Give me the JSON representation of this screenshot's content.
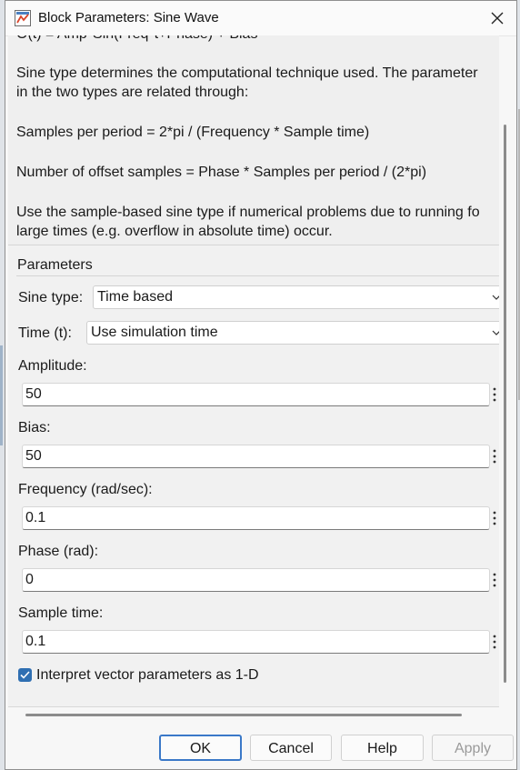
{
  "window": {
    "title": "Block Parameters: Sine Wave"
  },
  "description": {
    "formula_partial": "O(t) = Amp*Sin(Freq*t+Phase) + Bias",
    "line1": "Sine type determines the computational technique used. The parameter",
    "line2": "in the two types are related through:",
    "line3": "Samples per period = 2*pi / (Frequency * Sample time)",
    "line4": "Number of offset samples = Phase * Samples per period / (2*pi)",
    "line5": "Use the sample-based sine type if numerical problems due to running fo",
    "line6": "large times (e.g. overflow in absolute time) occur."
  },
  "parameters": {
    "group_label": "Parameters",
    "sine_type": {
      "label": "Sine type:",
      "value": "Time based"
    },
    "time": {
      "label": "Time (t):",
      "value": "Use simulation time"
    },
    "amplitude": {
      "label": "Amplitude:",
      "value": "50"
    },
    "bias": {
      "label": "Bias:",
      "value": "50"
    },
    "frequency": {
      "label": "Frequency (rad/sec):",
      "value": "0.1"
    },
    "phase": {
      "label": "Phase (rad):",
      "value": "0"
    },
    "sample_time": {
      "label": "Sample time:",
      "value": "0.1"
    },
    "interpret_vector": {
      "label": "Interpret vector parameters as 1-D",
      "checked": true
    }
  },
  "buttons": {
    "ok": "OK",
    "cancel": "Cancel",
    "help": "Help",
    "apply": "Apply"
  },
  "colors": {
    "accent": "#2f6fb2",
    "primary_border": "#3a78c8"
  }
}
